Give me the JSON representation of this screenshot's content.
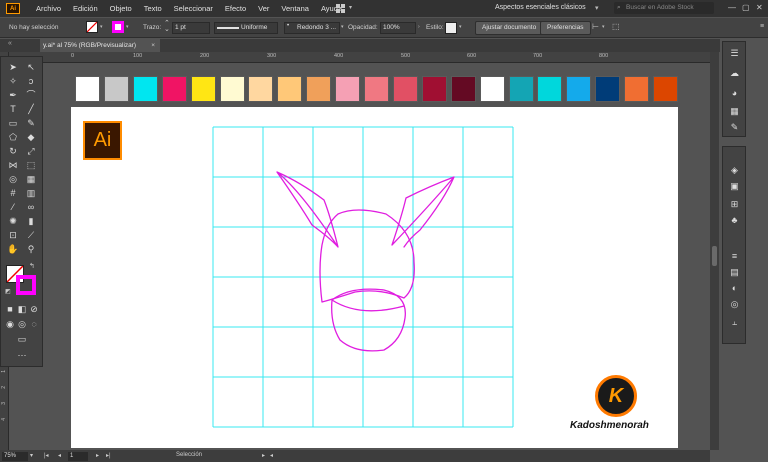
{
  "menubar": {
    "logo_text": "Ai",
    "items": [
      "Archivo",
      "Edición",
      "Objeto",
      "Texto",
      "Seleccionar",
      "Efecto",
      "Ver",
      "Ventana",
      "Ayuda"
    ],
    "workspace": "Aspectos esenciales clásicos",
    "search_placeholder": "Buscar en Adobe Stock"
  },
  "controlbar": {
    "selection_status": "No hay selección",
    "stroke_label": "Trazo:",
    "stroke_weight": "1 pt",
    "stroke_profile": "Uniforme",
    "brush": "Redondo 3 ...",
    "opacity_label": "Opacidad:",
    "opacity_value": "100%",
    "style_label": "Estilo:",
    "doc_setup_button": "Ajustar documento",
    "preferences_button": "Preferencias"
  },
  "document": {
    "tab_title": "y.ai* al 75% (RGB/Previsualizar)",
    "close_symbol": "×"
  },
  "rulers": {
    "top": [
      "0",
      "100",
      "200",
      "300",
      "400",
      "500",
      "600",
      "700",
      "800"
    ],
    "left": [
      "1",
      "2",
      "3",
      "4",
      "5",
      "6",
      "7",
      "8"
    ]
  },
  "swatches": [
    "#ffffff",
    "#c8c8c8",
    "#00e6f0",
    "#f01464",
    "#ffe614",
    "#fffad2",
    "#ffd7a0",
    "#ffc878",
    "#f0a05a",
    "#f5a0b4",
    "#f07882",
    "#e15064",
    "#a00f32",
    "#640a23",
    "#ffffff",
    "#14a5b4",
    "#00d7dc",
    "#14aaeb",
    "#003c78",
    "#f06e32",
    "#dc4600"
  ],
  "artwork": {
    "ai_logo_text": "Ai",
    "watermark_letter": "K",
    "watermark_name": "Kadoshmenorah",
    "grid_color": "#38e8f0",
    "stroke_color": "#e01ee0"
  },
  "statusbar": {
    "zoom": "75%",
    "artboard_number": "1",
    "tool_name": "Selección"
  },
  "colors": {
    "fill_swatch": "#ffffff",
    "stroke_swatch": "#ff00ff"
  }
}
